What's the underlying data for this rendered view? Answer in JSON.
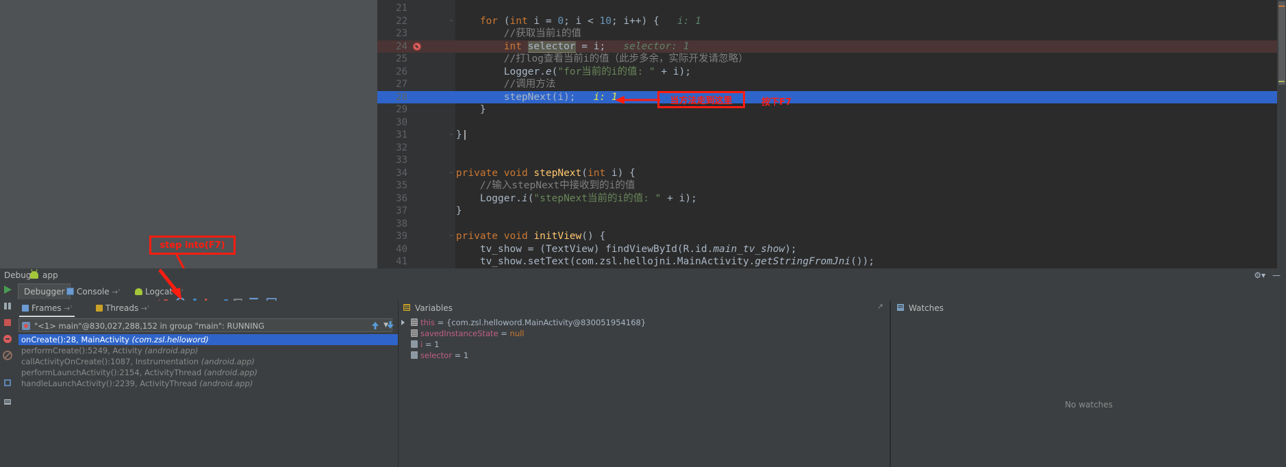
{
  "editor": {
    "lines": [
      {
        "num": "21",
        "segments": [],
        "state": "normal"
      },
      {
        "num": "22",
        "state": "normal",
        "fold": true,
        "segments": [
          {
            "t": "        ",
            "c": "ident"
          },
          {
            "t": "for ",
            "c": "kw"
          },
          {
            "t": "(",
            "c": "ident"
          },
          {
            "t": "int ",
            "c": "kw"
          },
          {
            "t": "i = ",
            "c": "ident"
          },
          {
            "t": "0",
            "c": "num-lit"
          },
          {
            "t": "; i < ",
            "c": "ident"
          },
          {
            "t": "10",
            "c": "num-lit"
          },
          {
            "t": "; i++) {   ",
            "c": "ident"
          },
          {
            "t": "i: 1",
            "c": "hint"
          }
        ]
      },
      {
        "num": "23",
        "state": "normal",
        "segments": [
          {
            "t": "            //获取当前i的值",
            "c": "cmt"
          }
        ]
      },
      {
        "num": "24",
        "state": "breakpoint",
        "breakpoint": true,
        "segments": [
          {
            "t": "            ",
            "c": "ident"
          },
          {
            "t": "int ",
            "c": "kw"
          },
          {
            "t": "selector",
            "c": "sel-tok"
          },
          {
            "t": " = i;   ",
            "c": "ident"
          },
          {
            "t": "selector: 1",
            "c": "hint"
          }
        ]
      },
      {
        "num": "25",
        "state": "normal",
        "segments": [
          {
            "t": "            //打log查看当前i的值（此步多余，实际开发请忽略）",
            "c": "cmt"
          }
        ]
      },
      {
        "num": "26",
        "state": "normal",
        "segments": [
          {
            "t": "            Logger.",
            "c": "ident"
          },
          {
            "t": "e",
            "c": "static-it"
          },
          {
            "t": "(",
            "c": "ident"
          },
          {
            "t": "\"for当前的i的值: \"",
            "c": "str"
          },
          {
            "t": " + i);",
            "c": "ident"
          }
        ]
      },
      {
        "num": "27",
        "state": "normal",
        "segments": [
          {
            "t": "            //调用方法",
            "c": "cmt"
          }
        ]
      },
      {
        "num": "28",
        "state": "executing",
        "segments": [
          {
            "t": "            stepNext(i);   ",
            "c": "ident"
          },
          {
            "t": "i: 1",
            "c": "hint-y"
          }
        ]
      },
      {
        "num": "29",
        "state": "normal",
        "segments": [
          {
            "t": "        }",
            "c": "ident"
          }
        ]
      },
      {
        "num": "30",
        "state": "normal",
        "segments": []
      },
      {
        "num": "31",
        "state": "normal",
        "fold": true,
        "segments": [
          {
            "t": "    }",
            "c": "ident"
          },
          {
            "t": "|",
            "c": "caret"
          }
        ]
      },
      {
        "num": "32",
        "state": "normal",
        "segments": []
      },
      {
        "num": "33",
        "state": "normal",
        "segments": []
      },
      {
        "num": "34",
        "state": "normal",
        "fold": true,
        "segments": [
          {
            "t": "    ",
            "c": "ident"
          },
          {
            "t": "private void ",
            "c": "kw"
          },
          {
            "t": "stepNext",
            "c": "mth"
          },
          {
            "t": "(",
            "c": "ident"
          },
          {
            "t": "int ",
            "c": "kw"
          },
          {
            "t": "i) {",
            "c": "ident"
          }
        ]
      },
      {
        "num": "35",
        "state": "normal",
        "segments": [
          {
            "t": "        //输入stepNext中接收到的i的值",
            "c": "cmt"
          }
        ]
      },
      {
        "num": "36",
        "state": "normal",
        "segments": [
          {
            "t": "        Logger.",
            "c": "ident"
          },
          {
            "t": "i",
            "c": "static-it"
          },
          {
            "t": "(",
            "c": "ident"
          },
          {
            "t": "\"stepNext当前的i的值: \"",
            "c": "str"
          },
          {
            "t": " + i);",
            "c": "ident"
          }
        ]
      },
      {
        "num": "37",
        "state": "normal",
        "segments": [
          {
            "t": "    }",
            "c": "ident"
          }
        ]
      },
      {
        "num": "38",
        "state": "normal",
        "segments": []
      },
      {
        "num": "39",
        "state": "normal",
        "fold": true,
        "segments": [
          {
            "t": "    ",
            "c": "ident"
          },
          {
            "t": "private void ",
            "c": "kw"
          },
          {
            "t": "initView",
            "c": "mth"
          },
          {
            "t": "() {",
            "c": "ident"
          }
        ]
      },
      {
        "num": "40",
        "state": "normal",
        "segments": [
          {
            "t": "        tv_show = (TextView) findViewById(R.id.",
            "c": "ident"
          },
          {
            "t": "main_tv_show",
            "c": "static-it"
          },
          {
            "t": ");",
            "c": "ident"
          }
        ]
      },
      {
        "num": "41",
        "state": "normal",
        "segments": [
          {
            "t": "        tv_show.setText(com.zsl.hellojni.MainActivity.",
            "c": "ident"
          },
          {
            "t": "getStringFromJni",
            "c": "static-it"
          },
          {
            "t": "());",
            "c": "ident"
          }
        ]
      }
    ]
  },
  "annotations": {
    "code_box_label": "当方法走到这里",
    "code_side_label": "按下F7",
    "step_into_label": "step into(F7)"
  },
  "debug": {
    "title": "Debug",
    "app_name": "app",
    "tabs": [
      {
        "label": "Debugger",
        "active": true,
        "icon": "none"
      },
      {
        "label": "Console",
        "active": false,
        "icon": "console-icon"
      },
      {
        "label": "Logcat",
        "active": false,
        "icon": "android-icon"
      }
    ],
    "toolbar_icons": [
      "show-execution-point-icon",
      "step-over-icon",
      "step-into-icon",
      "force-step-into-icon",
      "step-out-icon",
      "drop-frame-icon",
      "run-to-cursor-icon",
      "evaluate-expression-icon"
    ],
    "rail_icons": [
      "resume-program-icon",
      "pause-program-icon",
      "stop-icon",
      "view-breakpoints-icon",
      "mute-breakpoints-icon",
      "settings-icon",
      "pin-icon"
    ],
    "frames": {
      "tabs": [
        {
          "label": "Frames",
          "active": true,
          "icon": "frames-icon"
        },
        {
          "label": "Threads",
          "active": false,
          "icon": "threads-icon"
        }
      ],
      "thread_selector": "\"<1> main\"@830,027,288,152 in group \"main\": RUNNING",
      "stack": [
        {
          "text": "onCreate():28, MainActivity ",
          "pkg": "(com.zsl.helloword)",
          "selected": true
        },
        {
          "text": "performCreate():5249, Activity ",
          "pkg": "(android.app)",
          "selected": false
        },
        {
          "text": "callActivityOnCreate():1087, Instrumentation ",
          "pkg": "(android.app)",
          "selected": false
        },
        {
          "text": "performLaunchActivity():2154, ActivityThread ",
          "pkg": "(android.app)",
          "selected": false
        },
        {
          "text": "handleLaunchActivity():2239, ActivityThread ",
          "pkg": "(android.app)",
          "selected": false
        }
      ]
    },
    "variables": {
      "title": "Variables",
      "rows": [
        {
          "name": "this",
          "eq": " = ",
          "value": "{com.zsl.helloword.MainActivity@830051954168}",
          "icon": "object-icon",
          "expandable": true,
          "indent": 0
        },
        {
          "name": "savedInstanceState",
          "eq": " = ",
          "value": "null",
          "icon": "object-icon",
          "expandable": false,
          "indent": 0,
          "value_class": "var-null"
        },
        {
          "name": "i",
          "eq": " = ",
          "value": "1",
          "icon": "primitive-icon",
          "expandable": false,
          "indent": 0
        },
        {
          "name": "selector",
          "eq": " = ",
          "value": "1",
          "icon": "primitive-icon",
          "expandable": false,
          "indent": 0
        }
      ]
    },
    "watches": {
      "title": "Watches",
      "empty_text": "No watches"
    }
  },
  "colors": {
    "accent_blue": "#2f65ca",
    "annotation_red": "#ff1d10",
    "editor_bg": "#2b2b2b",
    "panel_bg": "#3c3f41",
    "breakpoint_line": "#4b3434"
  }
}
